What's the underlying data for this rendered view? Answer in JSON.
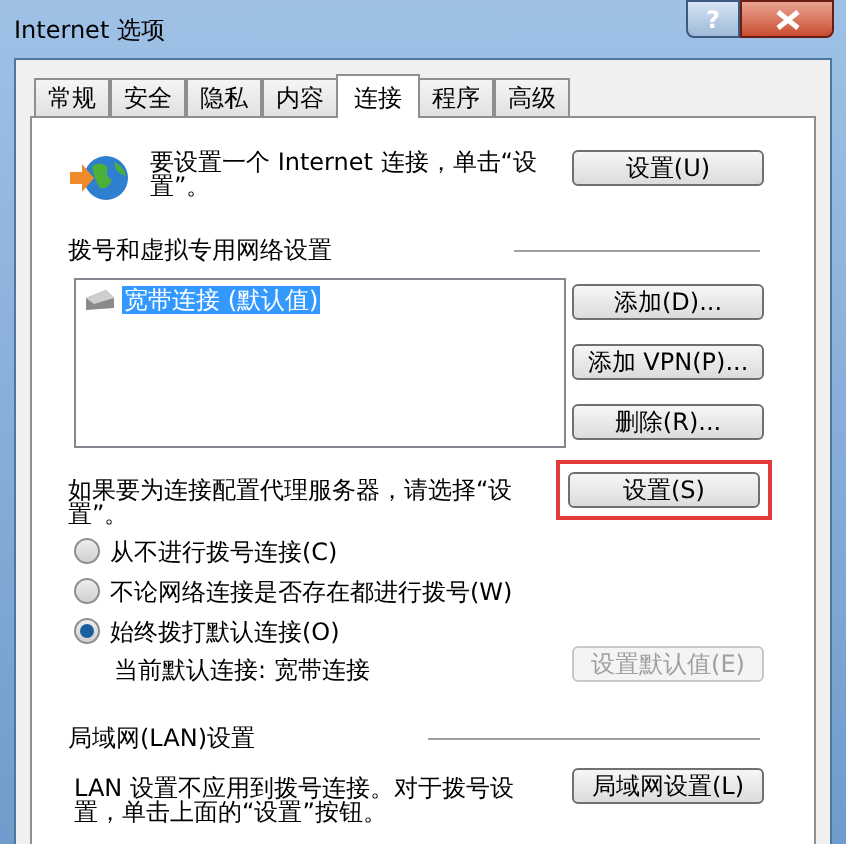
{
  "window": {
    "title": "Internet 选项",
    "help_label": "?"
  },
  "tabs": [
    {
      "label": "常规",
      "selected": false
    },
    {
      "label": "安全",
      "selected": false
    },
    {
      "label": "隐私",
      "selected": false
    },
    {
      "label": "内容",
      "selected": false
    },
    {
      "label": "连接",
      "selected": true
    },
    {
      "label": "程序",
      "selected": false
    },
    {
      "label": "高级",
      "selected": false
    }
  ],
  "intro": {
    "text": "要设置一个 Internet 连接，单击“设置”。",
    "button": "设置(U)"
  },
  "dialup": {
    "heading": "拨号和虚拟专用网络设置",
    "connections": [
      {
        "label": "宽带连接 (默认值)",
        "selected": true
      }
    ],
    "buttons": [
      "添加(D)...",
      "添加 VPN(P)...",
      "删除(R)..."
    ],
    "proxy_text": "如果要为连接配置代理服务器，请选择“设置”。",
    "proxy_button": {
      "label": "设置(S)",
      "highlighted": true
    },
    "options": [
      {
        "label": "从不进行拨号连接(C)",
        "selected": false
      },
      {
        "label": "不论网络连接是否存在都进行拨号(W)",
        "selected": false
      },
      {
        "label": "始终拨打默认连接(O)",
        "selected": true
      }
    ],
    "current_default": "当前默认连接: 宽带连接",
    "default_button": {
      "label": "设置默认值(E)",
      "disabled": true
    }
  },
  "lan": {
    "heading": "局域网(LAN)设置",
    "text": "LAN 设置不应用到拨号连接。对于拨号设置，单击上面的“设置”按钮。",
    "button": "局域网设置(L)"
  }
}
